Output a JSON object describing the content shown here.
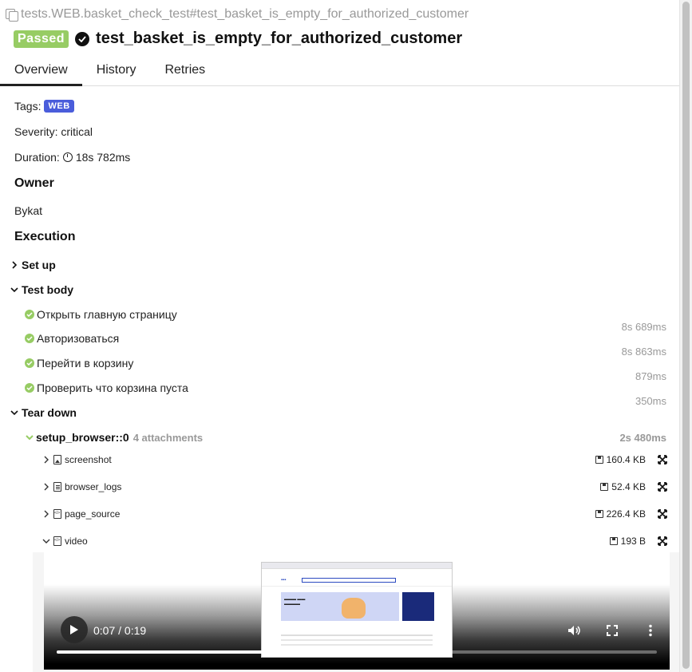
{
  "breadcrumb": "tests.WEB.basket_check_test#test_basket_is_empty_for_authorized_customer",
  "status": "Passed",
  "test_name": "test_basket_is_empty_for_authorized_customer",
  "tabs": [
    "Overview",
    "History",
    "Retries"
  ],
  "active_tab": "Overview",
  "tags_label": "Tags:",
  "tag": "WEB",
  "severity": "Severity: critical",
  "duration_label": "Duration:",
  "duration": "18s 782ms",
  "owner_heading": "Owner",
  "owner": "Bykat",
  "execution_heading": "Execution",
  "setup_label": "Set up",
  "test_body_label": "Test body",
  "steps": [
    {
      "name": "Открыть главную страницу",
      "duration": "8s 689ms"
    },
    {
      "name": "Авторизоваться",
      "duration": "8s 863ms"
    },
    {
      "name": "Перейти в корзину",
      "duration": "879ms"
    },
    {
      "name": "Проверить что корзина пуста",
      "duration": "350ms"
    }
  ],
  "teardown_label": "Tear down",
  "fixture": {
    "name": "setup_browser::0",
    "attachments": "4 attachments",
    "duration": "2s 480ms"
  },
  "attachments": [
    {
      "name": "screenshot",
      "icon": "image-file-icon",
      "size": "160.4 KB"
    },
    {
      "name": "browser_logs",
      "icon": "text-file-icon",
      "size": "52.4 KB"
    },
    {
      "name": "page_source",
      "icon": "code-file-icon",
      "size": "226.4 KB"
    },
    {
      "name": "video",
      "icon": "code-file-icon",
      "size": "193 B"
    }
  ],
  "video": {
    "time": "0:07 / 0:19",
    "progress": 0.37
  },
  "colors": {
    "passed": "#97cc64",
    "tag": "#4a5ddb",
    "muted": "#999999"
  }
}
